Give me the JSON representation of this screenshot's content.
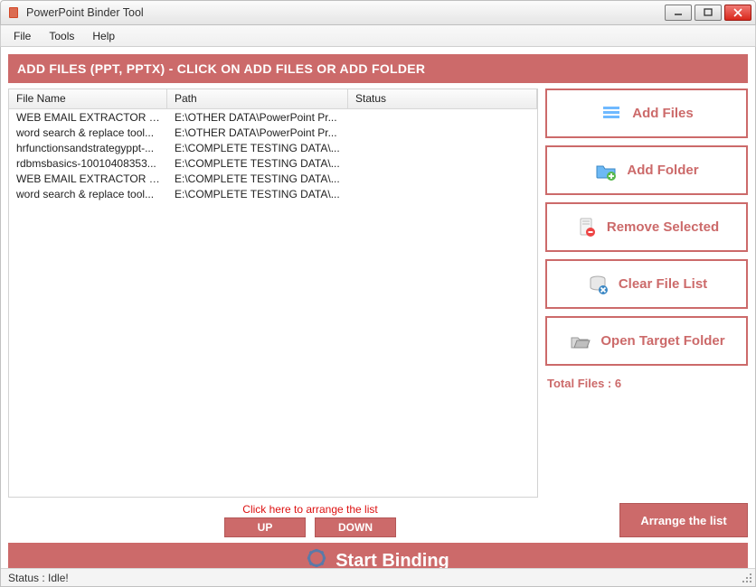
{
  "window": {
    "title": "PowerPoint Binder Tool"
  },
  "menu": {
    "file": "File",
    "tools": "Tools",
    "help": "Help"
  },
  "banner": "ADD FILES (PPT, PPTX) - CLICK ON ADD FILES OR ADD FOLDER",
  "columns": {
    "name": "File Name",
    "path": "Path",
    "status": "Status"
  },
  "rows": [
    {
      "name": "WEB EMAIL EXTRACTOR P...",
      "path": "E:\\OTHER DATA\\PowerPoint Pr...",
      "status": ""
    },
    {
      "name": "word search & replace tool...",
      "path": "E:\\OTHER DATA\\PowerPoint Pr...",
      "status": ""
    },
    {
      "name": "hrfunctionsandstrategyppt-...",
      "path": "E:\\COMPLETE TESTING DATA\\...",
      "status": ""
    },
    {
      "name": "rdbmsbasics-10010408353...",
      "path": "E:\\COMPLETE TESTING DATA\\...",
      "status": ""
    },
    {
      "name": "WEB EMAIL EXTRACTOR P...",
      "path": "E:\\COMPLETE TESTING DATA\\...",
      "status": ""
    },
    {
      "name": "word search & replace tool...",
      "path": "E:\\COMPLETE TESTING DATA\\...",
      "status": ""
    }
  ],
  "actions": {
    "add_files": "Add Files",
    "add_folder": "Add Folder",
    "remove_selected": "Remove Selected",
    "clear_list": "Clear File List",
    "open_target": "Open Target Folder"
  },
  "totals_label": "Total Files : 6",
  "arrange": {
    "hint": "Click here to arrange the list",
    "up": "UP",
    "down": "DOWN",
    "arrange": "Arrange the list"
  },
  "start_label": "Start Binding",
  "status_label": "Status  :  Idle!"
}
